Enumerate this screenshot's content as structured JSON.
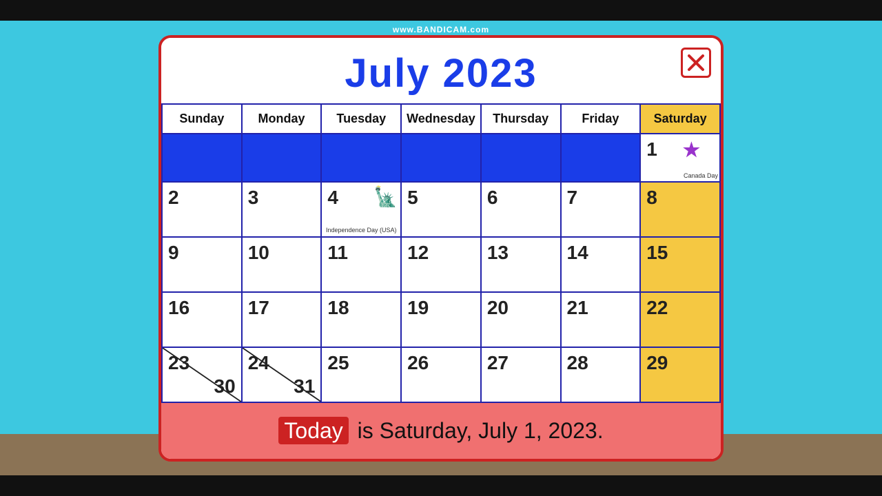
{
  "watermark": "www.BANDICAM.com",
  "calendar": {
    "title": "July 2023",
    "days_of_week": [
      "Sunday",
      "Monday",
      "Tuesday",
      "Wednesday",
      "Thursday",
      "Friday",
      "Saturday"
    ],
    "rows": [
      [
        null,
        null,
        null,
        null,
        null,
        null,
        {
          "day": 1,
          "holiday": "Canada Day",
          "saturday": true
        }
      ],
      [
        {
          "day": 2
        },
        {
          "day": 3
        },
        {
          "day": 4,
          "holiday": "Independence Day (USA)"
        },
        {
          "day": 5
        },
        {
          "day": 6
        },
        {
          "day": 7
        },
        {
          "day": 8,
          "saturday": true
        }
      ],
      [
        {
          "day": 9
        },
        {
          "day": 10
        },
        {
          "day": 11
        },
        {
          "day": 12
        },
        {
          "day": 13
        },
        {
          "day": 14
        },
        {
          "day": 15,
          "saturday": true
        }
      ],
      [
        {
          "day": 16
        },
        {
          "day": 17
        },
        {
          "day": 18
        },
        {
          "day": 19
        },
        {
          "day": 20
        },
        {
          "day": 21
        },
        {
          "day": 22,
          "saturday": true
        }
      ],
      [
        {
          "day": 23,
          "also": 30
        },
        {
          "day": 24,
          "also": 31
        },
        {
          "day": 25
        },
        {
          "day": 26
        },
        {
          "day": 27
        },
        {
          "day": 28
        },
        {
          "day": 29,
          "saturday": true
        }
      ]
    ],
    "footer": {
      "today_label": "Today",
      "rest": " is Saturday, July 1, 2023."
    }
  }
}
